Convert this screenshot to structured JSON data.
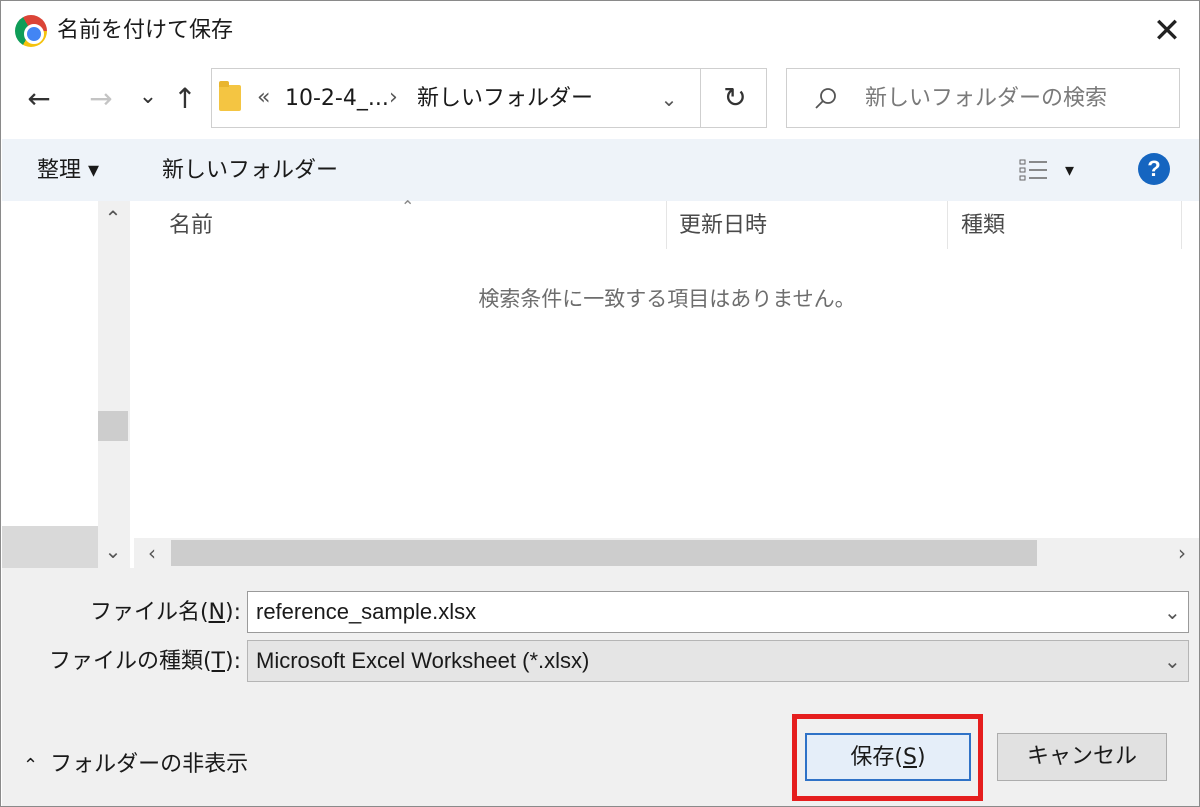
{
  "window": {
    "title": "名前を付けて保存",
    "close_icon": "close-icon"
  },
  "nav": {
    "back_icon": "←",
    "forward_icon": "→",
    "recent_icon": "⌄",
    "up_icon": "↑",
    "breadcrumb_overflow": "«",
    "breadcrumb_parent": "10-2-4_...",
    "breadcrumb_sep": "›",
    "breadcrumb_current": "新しいフォルダー",
    "refresh_icon": "↻",
    "search_placeholder": "新しいフォルダーの検索"
  },
  "toolbar": {
    "organize_label": "整理 ▾",
    "new_folder_label": "新しいフォルダー",
    "view_caret": "▾",
    "help_label": "?"
  },
  "file_list": {
    "columns": [
      "名前",
      "更新日時",
      "種類"
    ],
    "empty_message": "検索条件に一致する項目はありません。"
  },
  "form": {
    "filename_label": "ファイル名(N):",
    "filename_label_pre": "ファイル名(",
    "filename_label_key": "N",
    "filename_label_post": "):",
    "filename_value": "reference_sample.xlsx",
    "filetype_label_pre": "ファイルの種類(",
    "filetype_label_key": "T",
    "filetype_label_post": "):",
    "filetype_value": "Microsoft Excel Worksheet (*.xlsx)"
  },
  "footer": {
    "hide_folders_label": "フォルダーの非表示",
    "save_pre": "保存(",
    "save_key": "S",
    "save_post": ")",
    "cancel_label": "キャンセル"
  },
  "colors": {
    "highlight": "#e51e1e",
    "accent": "#2f72c7",
    "help": "#1565c0"
  }
}
